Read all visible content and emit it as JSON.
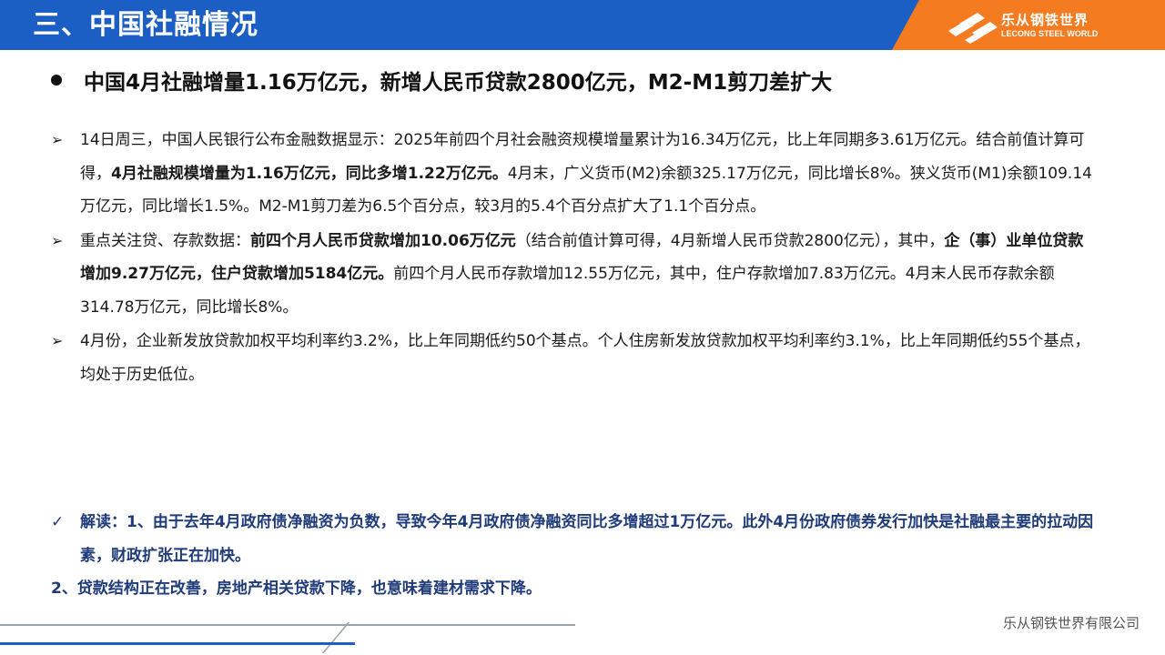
{
  "header": {
    "title": "三、中国社融情况",
    "brand_cn": "乐从钢铁世界",
    "brand_en": "LECONG STEEL WORLD",
    "logo_icon": "lecong-logo-icon",
    "colors": {
      "primary": "#1b5fc4",
      "accent": "#f47b20"
    }
  },
  "headline": "中国4月社融增量1.16万亿元，新增人民币贷款2800亿元，M2-M1剪刀差扩大",
  "bullets": [
    {
      "marker": "➢",
      "parts": [
        {
          "text": "14日周三，中国人民银行公布金融数据显示：2025年前四个月社会融资规模增量累计为16.34万亿元，比上年同期多3.61万亿元。结合前值计算可得，",
          "bold": false
        },
        {
          "text": "4月社融规模增量为1.16万亿元，同比多增1.22万亿元。",
          "bold": true
        },
        {
          "text": "4月末，广义货币(M2)余额325.17万亿元，同比增长8%。狭义货币(M1)余额109.14万亿元，同比增长1.5%。M2-M1剪刀差为6.5个百分点，较3月的5.4个百分点扩大了1.1个百分点。",
          "bold": false
        }
      ]
    },
    {
      "marker": "➢",
      "parts": [
        {
          "text": "重点关注贷、存款数据：",
          "bold": false
        },
        {
          "text": "前四个月人民币贷款增加10.06万亿元",
          "bold": true
        },
        {
          "text": "（结合前值计算可得，4月新增人民币贷款2800亿元），其中，",
          "bold": false
        },
        {
          "text": "企（事）业单位贷款增加9.27万亿元，住户贷款增加5184亿元。",
          "bold": true
        },
        {
          "text": "前四个月人民币存款增加12.55万亿元，其中，住户存款增加7.83万亿元。4月末人民币存款余额314.78万亿元，同比增长8%。",
          "bold": false
        }
      ]
    },
    {
      "marker": "➢",
      "parts": [
        {
          "text": "4月份，企业新发放贷款加权平均利率约3.2%，比上年同期低约50个基点。个人住房新发放贷款加权平均利率约3.1%，比上年同期低约55个基点，均处于历史低位。",
          "bold": false
        }
      ]
    }
  ],
  "insight": {
    "check": "✓",
    "line1": "解读：1、由于去年4月政府债净融资为负数，导致今年4月政府债净融资同比多增超过1万亿元。此外4月份政府债券发行加快是社融最主要的拉动因素，财政扩张正在加快。",
    "line2": "2、贷款结构正在改善，房地产相关贷款下降，也意味着建材需求下降。"
  },
  "footer": {
    "company": "乐从钢铁世界有限公司"
  }
}
